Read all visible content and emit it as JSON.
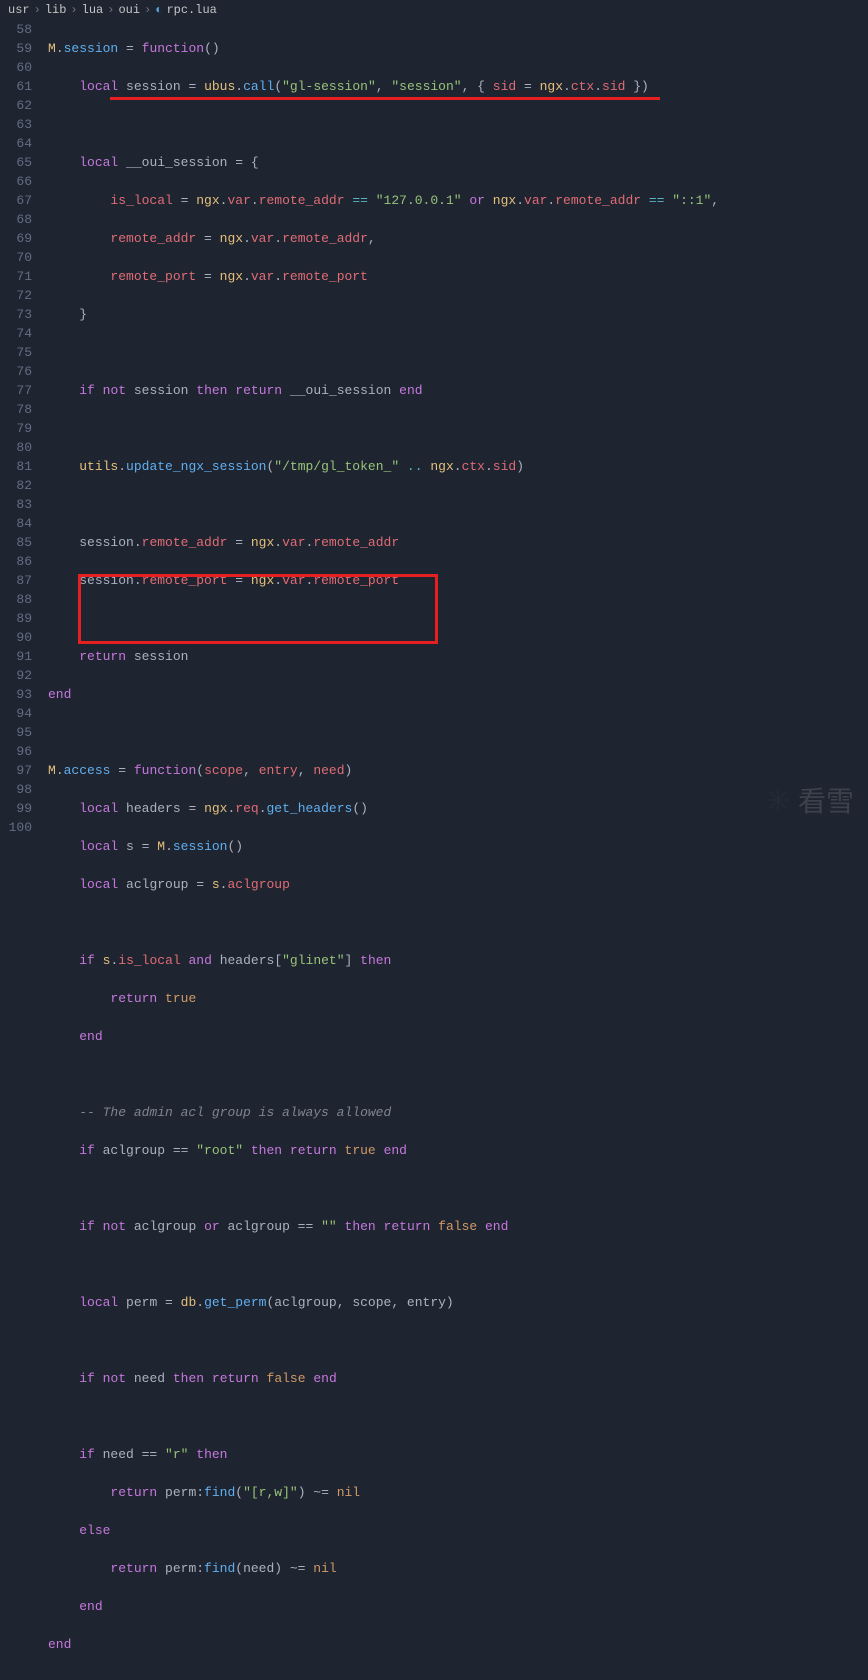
{
  "breadcrumb": {
    "part1": "usr",
    "part2": "lib",
    "part3": "lua",
    "part4": "oui",
    "file": "rpc.lua"
  },
  "code": {
    "lines": [
      "58",
      "59",
      "60",
      "61",
      "62",
      "63",
      "64",
      "65",
      "66",
      "67",
      "68",
      "69",
      "70",
      "71",
      "72",
      "73",
      "74",
      "75",
      "76",
      "77",
      "78",
      "79",
      "80",
      "81",
      "82",
      "83",
      "84",
      "85",
      "86",
      "87",
      "88",
      "89",
      "90",
      "91",
      "92",
      "93",
      "94",
      "95",
      "96",
      "97",
      "98",
      "99",
      "100"
    ],
    "l58_a": "M",
    "l58_b": ".",
    "l58_c": "session",
    "l58_d": " = ",
    "l58_e": "function",
    "l58_f": "()",
    "l59_a": "local",
    "l59_b": " session = ",
    "l59_c": "ubus",
    "l59_d": ".",
    "l59_e": "call",
    "l59_f": "(",
    "l59_g": "\"gl-session\"",
    "l59_h": ", ",
    "l59_i": "\"session\"",
    "l59_j": ", { ",
    "l59_k": "sid",
    "l59_l": " = ",
    "l59_m": "ngx",
    "l59_n": ".",
    "l59_o": "ctx",
    "l59_p": ".",
    "l59_q": "sid",
    "l59_r": " })",
    "l61_a": "local",
    "l61_b": " __oui_session = {",
    "l62_a": "is_local",
    "l62_b": " = ",
    "l62_c": "ngx",
    "l62_d": ".",
    "l62_e": "var",
    "l62_f": ".",
    "l62_g": "remote_addr",
    "l62_h": " == ",
    "l62_i": "\"127.0.0.1\"",
    "l62_j": " ",
    "l62_k": "or",
    "l62_l": " ",
    "l62_m": "ngx",
    "l62_n": ".",
    "l62_o": "var",
    "l62_p": ".",
    "l62_q": "remote_addr",
    "l62_r": " == ",
    "l62_s": "\"::1\"",
    "l62_t": ",",
    "l63_a": "remote_addr",
    "l63_b": " = ",
    "l63_c": "ngx",
    "l63_d": ".",
    "l63_e": "var",
    "l63_f": ".",
    "l63_g": "remote_addr",
    "l63_h": ",",
    "l64_a": "remote_port",
    "l64_b": " = ",
    "l64_c": "ngx",
    "l64_d": ".",
    "l64_e": "var",
    "l64_f": ".",
    "l64_g": "remote_port",
    "l65_a": "}",
    "l67_a": "if",
    "l67_b": " ",
    "l67_c": "not",
    "l67_d": " session ",
    "l67_e": "then",
    "l67_f": " ",
    "l67_g": "return",
    "l67_h": " __oui_session ",
    "l67_i": "end",
    "l69_a": "utils",
    "l69_b": ".",
    "l69_c": "update_ngx_session",
    "l69_d": "(",
    "l69_e": "\"/tmp/gl_token_\"",
    "l69_f": " .. ",
    "l69_g": "ngx",
    "l69_h": ".",
    "l69_i": "ctx",
    "l69_j": ".",
    "l69_k": "sid",
    "l69_l": ")",
    "l71_a": "session",
    "l71_b": ".",
    "l71_c": "remote_addr",
    "l71_d": " = ",
    "l71_e": "ngx",
    "l71_f": ".",
    "l71_g": "var",
    "l71_h": ".",
    "l71_i": "remote_addr",
    "l72_a": "session",
    "l72_b": ".",
    "l72_c": "remote_port",
    "l72_d": " = ",
    "l72_e": "ngx",
    "l72_f": ".",
    "l72_g": "var",
    "l72_h": ".",
    "l72_i": "remote_port",
    "l74_a": "return",
    "l74_b": " session",
    "l75_a": "end",
    "l77_a": "M",
    "l77_b": ".",
    "l77_c": "access",
    "l77_d": " = ",
    "l77_e": "function",
    "l77_f": "(",
    "l77_g": "scope",
    "l77_h": ", ",
    "l77_i": "entry",
    "l77_j": ", ",
    "l77_k": "need",
    "l77_l": ")",
    "l78_a": "local",
    "l78_b": " headers = ",
    "l78_c": "ngx",
    "l78_d": ".",
    "l78_e": "req",
    "l78_f": ".",
    "l78_g": "get_headers",
    "l78_h": "()",
    "l79_a": "local",
    "l79_b": " s = ",
    "l79_c": "M",
    "l79_d": ".",
    "l79_e": "session",
    "l79_f": "()",
    "l80_a": "local",
    "l80_b": " aclgroup = ",
    "l80_c": "s",
    "l80_d": ".",
    "l80_e": "aclgroup",
    "l82_a": "if",
    "l82_b": " ",
    "l82_c": "s",
    "l82_d": ".",
    "l82_e": "is_local",
    "l82_f": " ",
    "l82_g": "and",
    "l82_h": " headers[",
    "l82_i": "\"glinet\"",
    "l82_j": "] ",
    "l82_k": "then",
    "l83_a": "return",
    "l83_b": " ",
    "l83_c": "true",
    "l84_a": "end",
    "l86_a": "-- The admin acl group is always allowed",
    "l87_a": "if",
    "l87_b": " aclgroup == ",
    "l87_c": "\"root\"",
    "l87_d": " ",
    "l87_e": "then",
    "l87_f": " ",
    "l87_g": "return",
    "l87_h": " ",
    "l87_i": "true",
    "l87_j": " ",
    "l87_k": "end",
    "l89_a": "if",
    "l89_b": " ",
    "l89_c": "not",
    "l89_d": " aclgroup ",
    "l89_e": "or",
    "l89_f": " aclgroup == ",
    "l89_g": "\"\"",
    "l89_h": " ",
    "l89_i": "then",
    "l89_j": " ",
    "l89_k": "return",
    "l89_l": " ",
    "l89_m": "false",
    "l89_n": " ",
    "l89_o": "end",
    "l91_a": "local",
    "l91_b": " perm = ",
    "l91_c": "db",
    "l91_d": ".",
    "l91_e": "get_perm",
    "l91_f": "(aclgroup, scope, entry)",
    "l93_a": "if",
    "l93_b": " ",
    "l93_c": "not",
    "l93_d": " need ",
    "l93_e": "then",
    "l93_f": " ",
    "l93_g": "return",
    "l93_h": " ",
    "l93_i": "false",
    "l93_j": " ",
    "l93_k": "end",
    "l95_a": "if",
    "l95_b": " need == ",
    "l95_c": "\"r\"",
    "l95_d": " ",
    "l95_e": "then",
    "l96_a": "return",
    "l96_b": " perm:",
    "l96_c": "find",
    "l96_d": "(",
    "l96_e": "\"[r,w]\"",
    "l96_f": ") ~= ",
    "l96_g": "nil",
    "l97_a": "else",
    "l98_a": "return",
    "l98_b": " perm:",
    "l98_c": "find",
    "l98_d": "(need) ~= ",
    "l98_e": "nil",
    "l99_a": "end",
    "l100_a": "end"
  },
  "watermark": "看雪"
}
